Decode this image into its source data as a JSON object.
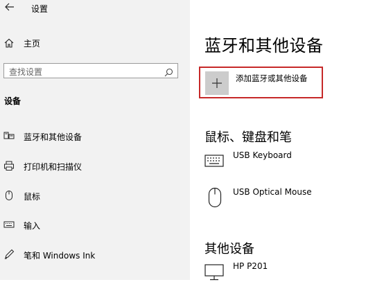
{
  "app": {
    "title": "设置"
  },
  "sidebar": {
    "home_label": "主页",
    "search_placeholder": "查找设置",
    "section_header": "设备",
    "items": [
      {
        "label": "蓝牙和其他设备",
        "icon": "bluetooth-devices-icon"
      },
      {
        "label": "打印机和扫描仪",
        "icon": "printer-icon"
      },
      {
        "label": "鼠标",
        "icon": "mouse-icon"
      },
      {
        "label": "输入",
        "icon": "keyboard-icon"
      },
      {
        "label": "笔和 Windows Ink",
        "icon": "pen-icon"
      }
    ]
  },
  "main": {
    "title": "蓝牙和其他设备",
    "add_device_label": "添加蓝牙或其他设备",
    "group_mouse_keyboard": {
      "title": "鼠标、键盘和笔",
      "devices": [
        {
          "name": "USB Keyboard",
          "icon": "keyboard-icon"
        },
        {
          "name": "USB Optical Mouse",
          "icon": "mouse-icon"
        }
      ]
    },
    "group_other": {
      "title": "其他设备",
      "devices": [
        {
          "name": "HP P201",
          "icon": "monitor-icon"
        }
      ]
    }
  },
  "colors": {
    "sidebar_bg": "#f2f2f2",
    "highlight_border": "#c62828",
    "plus_tile": "#cccccc"
  }
}
